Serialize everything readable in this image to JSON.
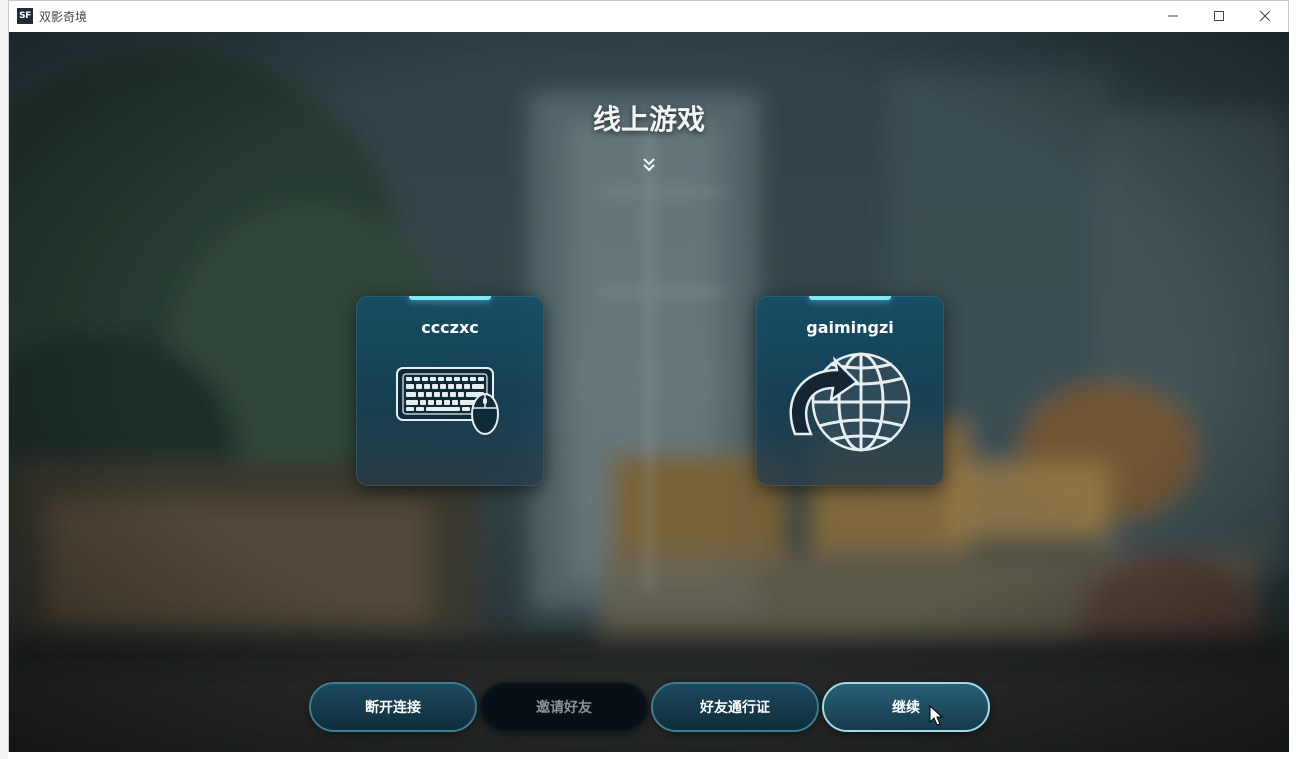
{
  "window": {
    "title": "双影奇境",
    "app_icon_text": "SF"
  },
  "screen": {
    "heading": "线上游戏"
  },
  "players": [
    {
      "name": "ccczxc",
      "input_icon": "keyboard-mouse-icon"
    },
    {
      "name": "gaimingzi",
      "input_icon": "online-globe-icon"
    }
  ],
  "buttons": {
    "disconnect": "断开连接",
    "invite_friend": "邀请好友",
    "friend_pass": "好友通行证",
    "continue": "继续"
  },
  "colors": {
    "card_accent": "#7fe6f4",
    "button_border": "#3a7e92",
    "button_fill": "#1c4a5e",
    "disabled_fill": "#071015"
  }
}
